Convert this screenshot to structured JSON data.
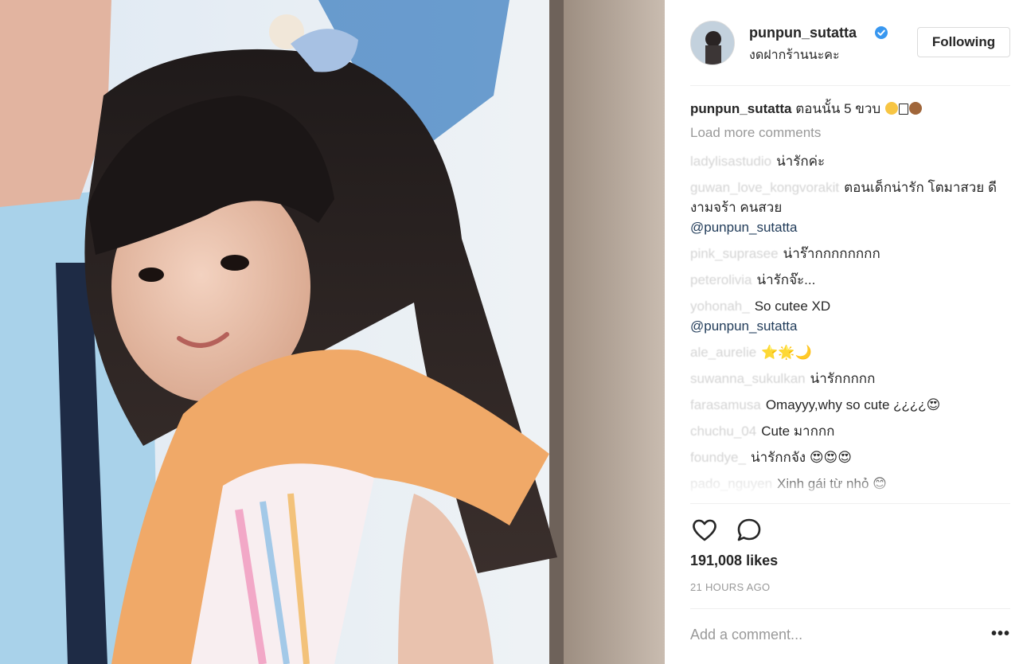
{
  "post": {
    "username": "punpun_sutatta",
    "location": "งดฝากร้านนะคะ",
    "follow_label": "Following",
    "caption": "ตอนนั้น 5 ขวบ",
    "load_more": "Load more comments",
    "likes": "191,008 likes",
    "time": "21 HOURS AGO",
    "add_comment_placeholder": "Add a comment...",
    "more_label": "•••"
  },
  "comments": [
    {
      "user": "ladylisastudio",
      "text": "น่ารักค่ะ",
      "mention": ""
    },
    {
      "user": "guwan_love_kongvorakit",
      "text": "ตอนเด็กน่ารัก โตมาสวย ดีงามจร้า คนสวย",
      "mention": "@punpun_sutatta"
    },
    {
      "user": "pink_suprasee",
      "text": "น่าร๊ากกกกกกกก",
      "mention": ""
    },
    {
      "user": "peterolivia",
      "text": "น่ารักจ๊ะ...",
      "mention": ""
    },
    {
      "user": "yohonah_",
      "text": "So cutee XD",
      "mention": "@punpun_sutatta"
    },
    {
      "user": "ale_aurelie",
      "text": "⭐🌟🌙",
      "mention": ""
    },
    {
      "user": "suwanna_sukulkan",
      "text": "น่ารักกกกก",
      "mention": ""
    },
    {
      "user": "farasamusa",
      "text": "Omayyy,why so cute ¿¿¿¿😍",
      "mention": ""
    },
    {
      "user": "chuchu_04",
      "text": "Cute มากกก",
      "mention": ""
    },
    {
      "user": "foundye_",
      "text": "น่ารักกจัง 😍😍😍",
      "mention": ""
    },
    {
      "user": "pado_nguyen",
      "text": "Xinh gái từ nhỏ 😊",
      "mention": ""
    }
  ],
  "icons": {
    "like": "heart-icon",
    "comment": "speech-bubble-icon",
    "verified": "verified-badge-icon",
    "more": "ellipsis-icon"
  },
  "colors": {
    "verified": "#3897f0",
    "muted_text": "#999999",
    "divider": "#efefef"
  }
}
